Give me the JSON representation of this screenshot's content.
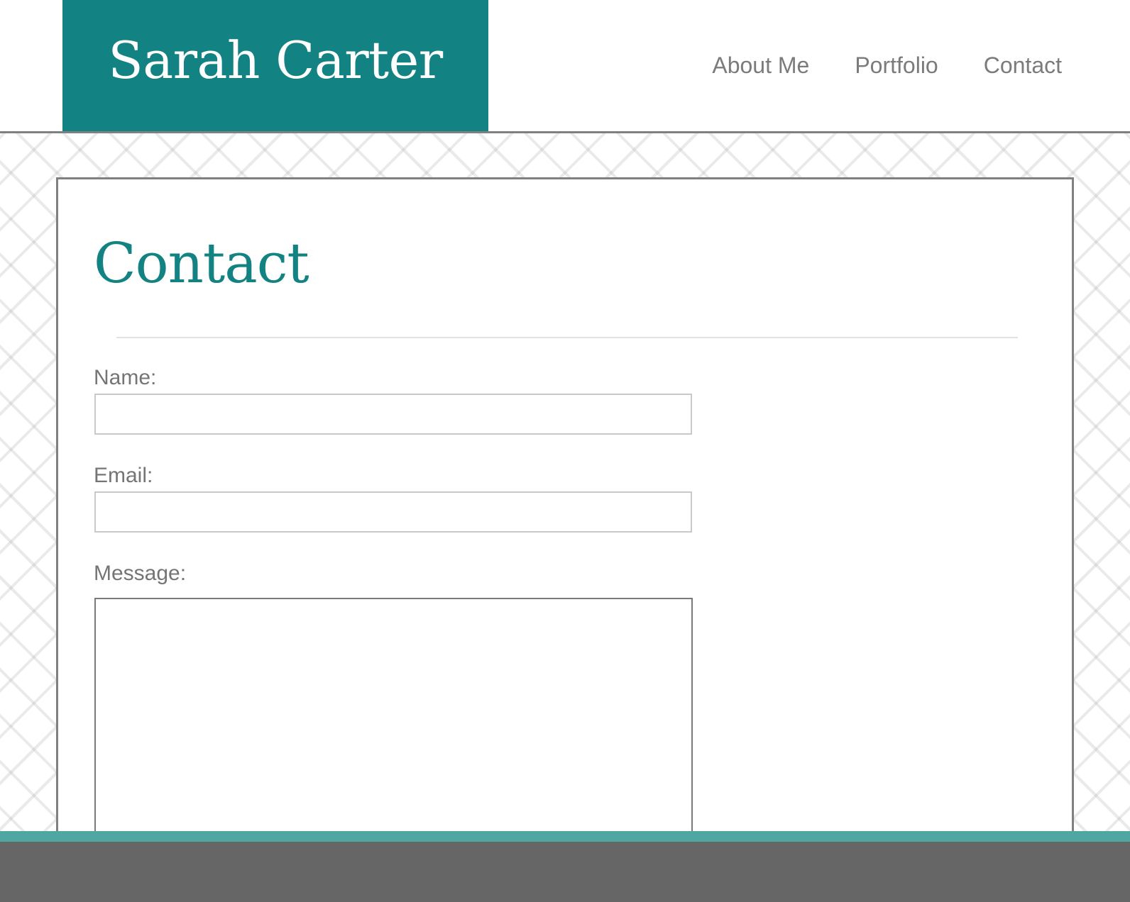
{
  "header": {
    "site_name": "Sarah Carter",
    "nav": [
      {
        "label": "About Me"
      },
      {
        "label": "Portfolio"
      },
      {
        "label": "Contact"
      }
    ]
  },
  "contact_form": {
    "title": "Contact",
    "name_label": "Name:",
    "name_value": "",
    "email_label": "Email:",
    "email_value": "",
    "message_label": "Message:",
    "message_value": ""
  },
  "colors": {
    "brand": "#138282",
    "footer_accent": "#4fa7a2",
    "footer": "#666666",
    "nav_text": "#7b7b7b"
  }
}
